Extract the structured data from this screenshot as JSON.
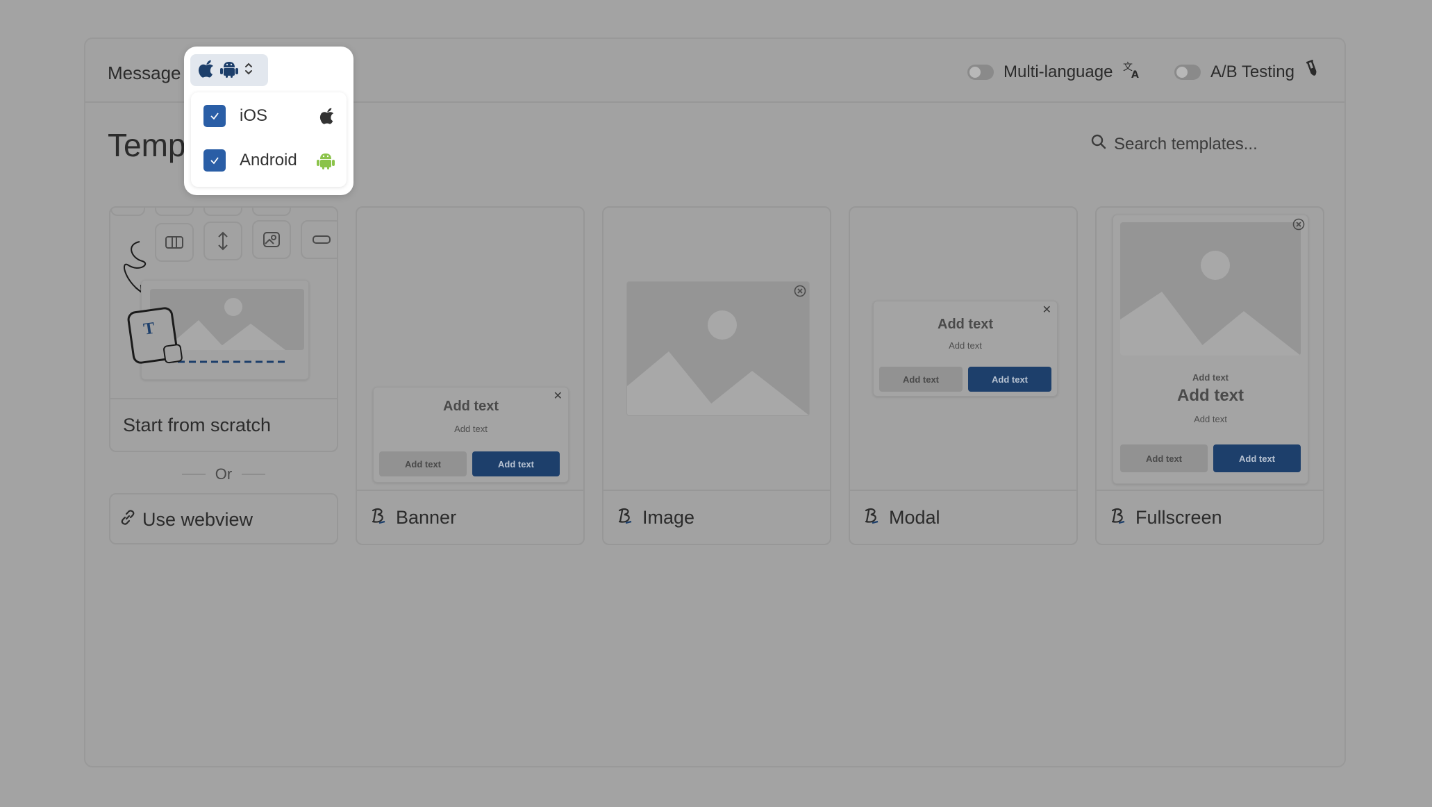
{
  "header": {
    "title": "Message",
    "multi_language_label": "Multi-language",
    "ab_testing_label": "A/B Testing"
  },
  "templates": {
    "heading": "Templa",
    "search_placeholder": "Search templates..."
  },
  "cards": {
    "scratch": {
      "label": "Start from scratch"
    },
    "or_label": "Or",
    "webview": {
      "label": "Use webview"
    },
    "banner": {
      "label": "Banner",
      "title": "Add text",
      "sub": "Add text",
      "btn_secondary": "Add text",
      "btn_primary": "Add text"
    },
    "image": {
      "label": "Image"
    },
    "modal": {
      "label": "Modal",
      "title": "Add text",
      "sub": "Add text",
      "btn_secondary": "Add text",
      "btn_primary": "Add text"
    },
    "fullscreen": {
      "label": "Fullscreen",
      "eyebrow": "Add text",
      "title": "Add text",
      "sub": "Add text",
      "btn_secondary": "Add text",
      "btn_primary": "Add text"
    }
  },
  "platform_menu": {
    "items": [
      {
        "label": "iOS",
        "checked": true,
        "icon": "apple-icon"
      },
      {
        "label": "Android",
        "checked": true,
        "icon": "android-icon"
      }
    ]
  },
  "colors": {
    "primary": "#1d3f6b",
    "checkbox": "#2a5ea6",
    "android": "#8bc34a"
  }
}
